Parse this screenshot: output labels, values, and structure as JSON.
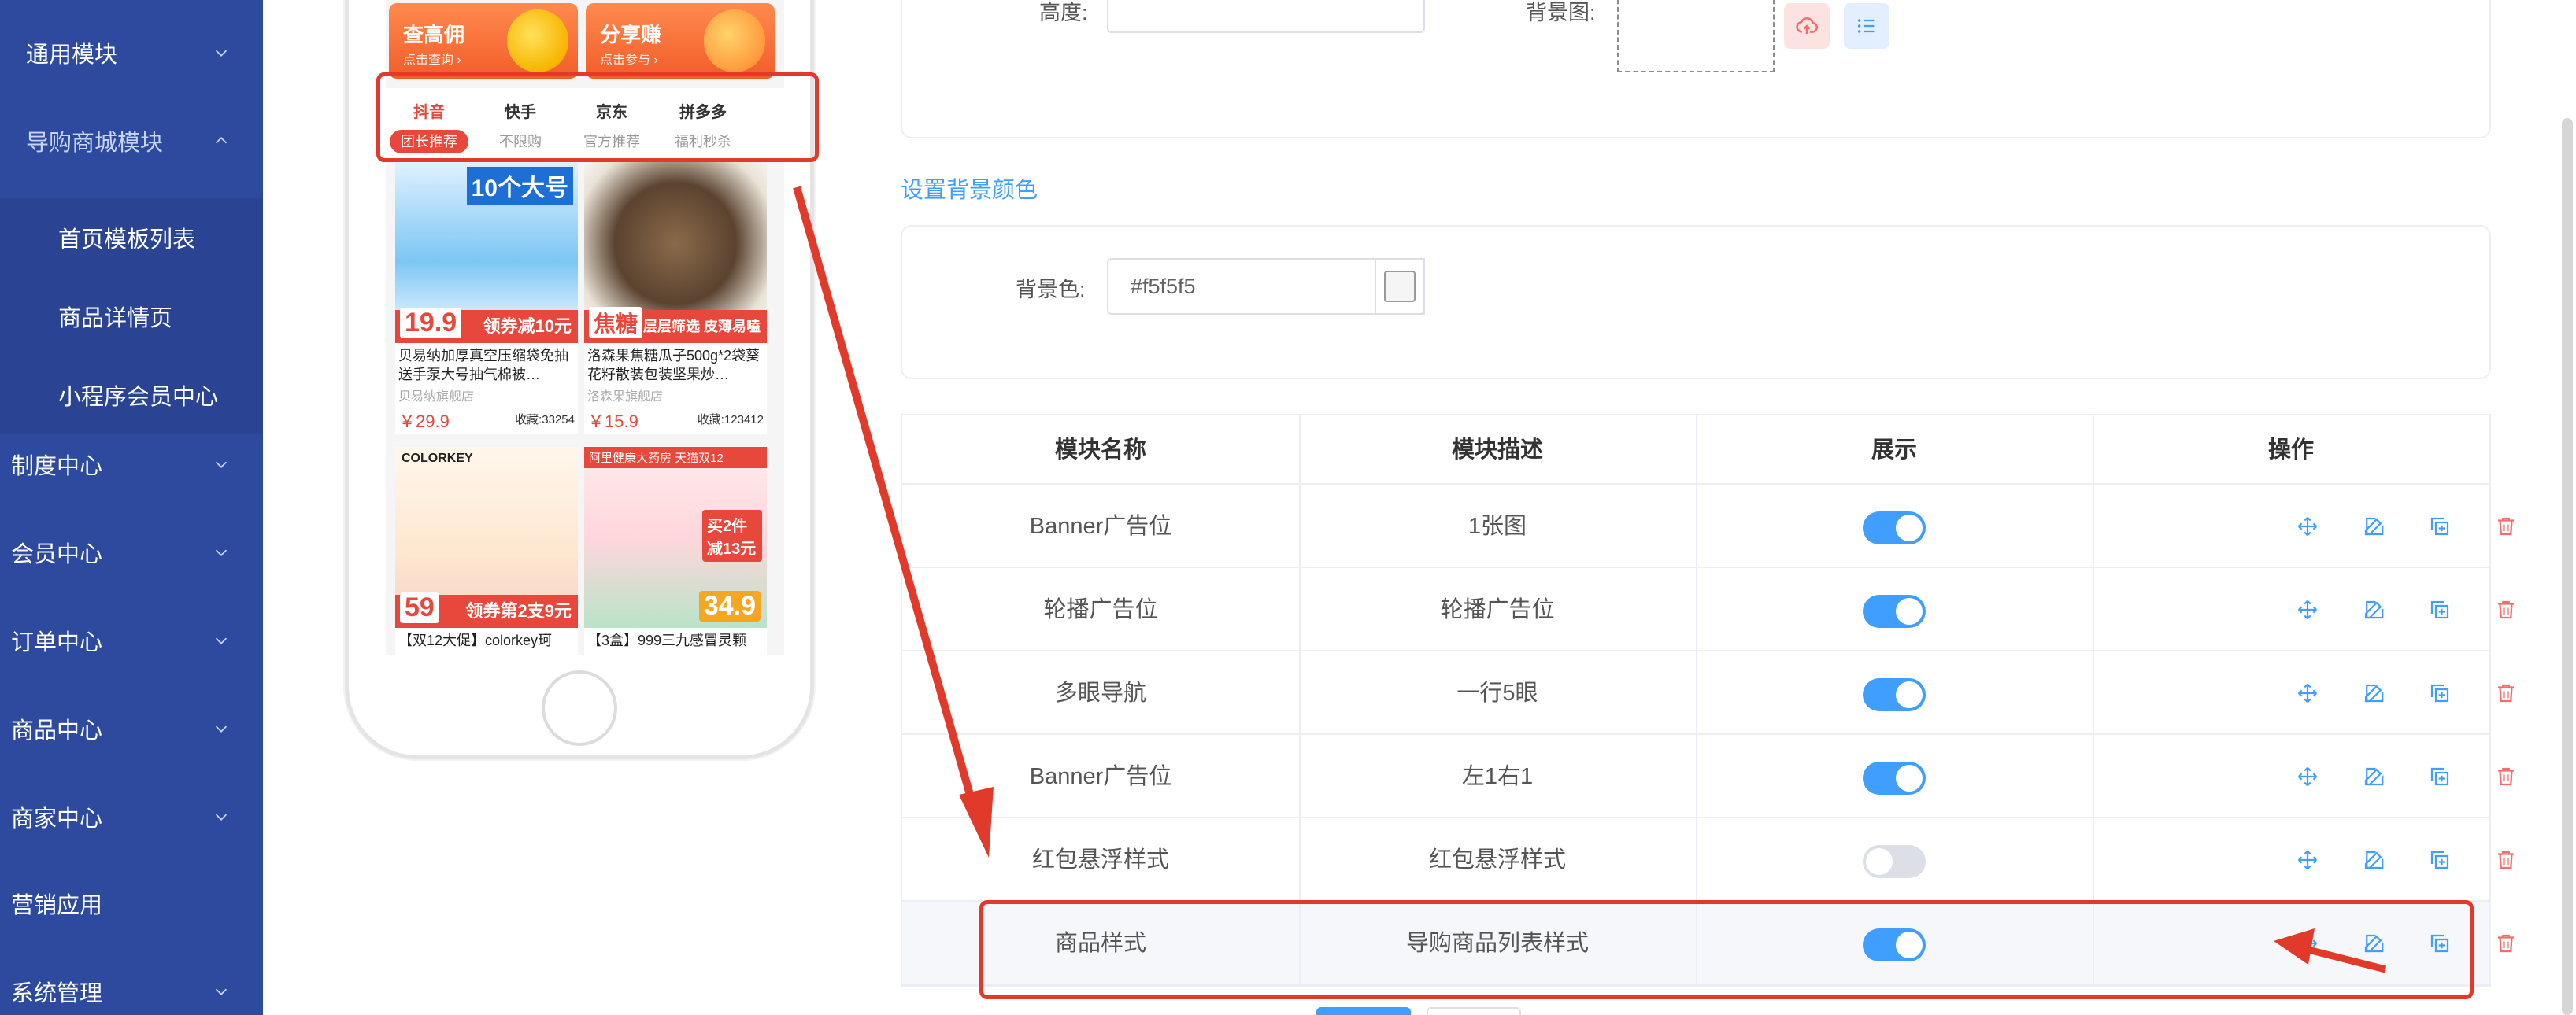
{
  "colors": {
    "sidebar_bg": "#2d4a9e",
    "accent": "#409eff",
    "danger": "#f56c6c",
    "annotation_red": "#e23a2a"
  },
  "sidebar": {
    "items": [
      {
        "label": "通用模块",
        "icon": "chevron-down-icon"
      },
      {
        "label": "导购商城模块",
        "icon": "chevron-up-icon"
      },
      {
        "label": "首页模板列表",
        "active": true
      },
      {
        "label": "商品详情页"
      },
      {
        "label": "小程序会员中心"
      },
      {
        "label": "制度中心",
        "icon": "chevron-down-icon"
      },
      {
        "label": "会员中心",
        "icon": "chevron-down-icon"
      },
      {
        "label": "订单中心",
        "icon": "chevron-down-icon"
      },
      {
        "label": "商品中心",
        "icon": "chevron-down-icon"
      },
      {
        "label": "商家中心",
        "icon": "chevron-down-icon"
      },
      {
        "label": "营销应用"
      },
      {
        "label": "系统管理",
        "icon": "chevron-down-icon"
      }
    ]
  },
  "preview": {
    "promos": [
      {
        "title": "查高佣",
        "sub": "点击查询 ›"
      },
      {
        "title": "分享赚",
        "sub": "点击参与 ›"
      }
    ],
    "platform_tabs": [
      {
        "name": "抖音",
        "desc": "团长推荐",
        "selected": true
      },
      {
        "name": "快手",
        "desc": "不限购"
      },
      {
        "name": "京东",
        "desc": "官方推荐"
      },
      {
        "name": "拼多多",
        "desc": "福利秒杀"
      }
    ],
    "goods": [
      {
        "title": "贝易纳加厚真空压缩袋免抽送手泵大号抽气棉被…",
        "shop": "贝易纳旗舰店",
        "price": "￥29.9",
        "fav": "收藏:33254",
        "badge": "10个大号",
        "band": "领券减10元",
        "tag": "19.9"
      },
      {
        "title": "洛森果焦糖瓜子500g*2袋葵花籽散装包装坚果炒…",
        "shop": "洛森果旗舰店",
        "price": "￥15.9",
        "fav": "收藏:123412",
        "band": "层层筛选 皮薄易嗑",
        "tag": "焦糖"
      },
      {
        "title": "【双12大促】colorkey珂",
        "tag": "59",
        "band": "领券第2支9元",
        "brand": "COLORKEY"
      },
      {
        "title": "【3盒】999三九感冒灵颗",
        "tag": "34.9",
        "band": "买2件减13元",
        "brand": "阿里健康大药房 天猫双12"
      }
    ]
  },
  "form": {
    "height_label": "高度:",
    "height_value": "",
    "bgimage_label": "背景图:",
    "bgcolor_section": "设置背景颜色",
    "bgcolor_label": "背景色:",
    "bgcolor_value": "#f5f5f5",
    "bgcolor_swatch": "#f5f5f5"
  },
  "table": {
    "headers": [
      "模块名称",
      "模块描述",
      "展示",
      "操作"
    ],
    "rows": [
      {
        "name": "Banner广告位",
        "desc": "1张图",
        "show": true
      },
      {
        "name": "轮播广告位",
        "desc": "轮播广告位",
        "show": true
      },
      {
        "name": "多眼导航",
        "desc": "一行5眼",
        "show": true
      },
      {
        "name": "Banner广告位",
        "desc": "左1右1",
        "show": true
      },
      {
        "name": "红包悬浮样式",
        "desc": "红包悬浮样式",
        "show": false
      },
      {
        "name": "商品样式",
        "desc": "导购商品列表样式",
        "show": true,
        "highlighted": true
      }
    ],
    "actions": [
      "move-icon",
      "edit-icon",
      "copy-icon",
      "delete-icon"
    ]
  }
}
